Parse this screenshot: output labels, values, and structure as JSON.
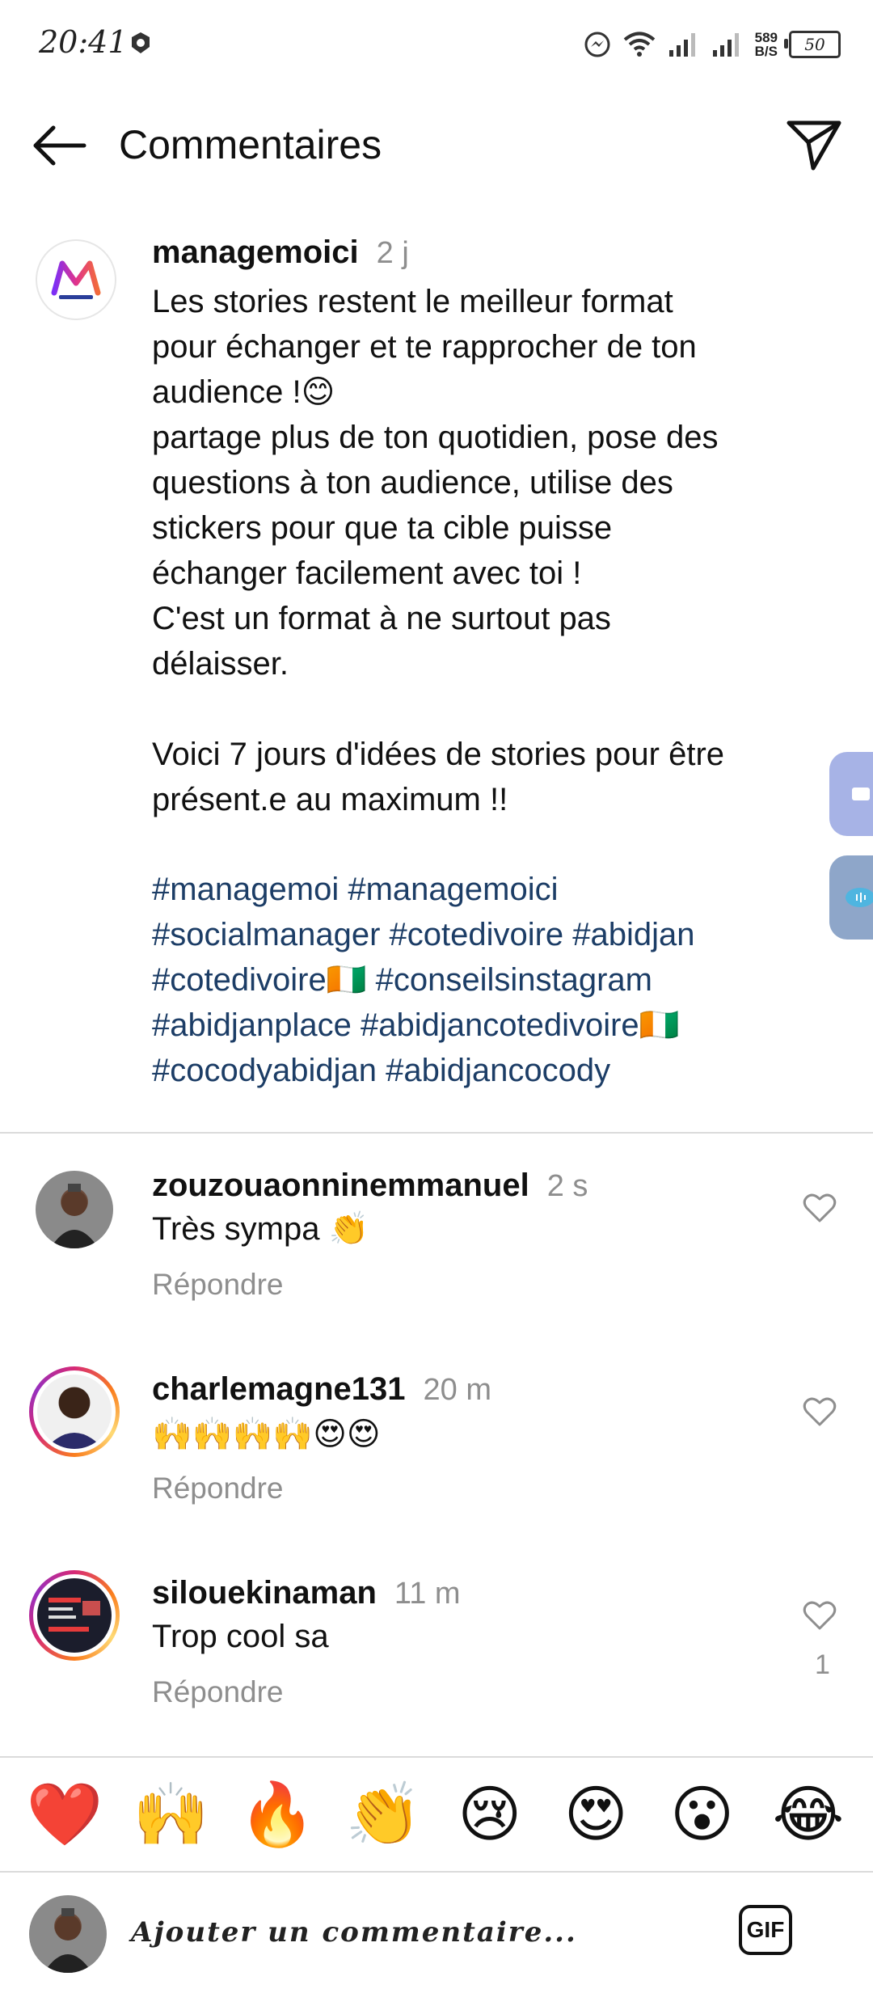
{
  "status_bar": {
    "time": "20:41",
    "speed_value": "589",
    "speed_unit": "B/S",
    "battery": "50"
  },
  "header": {
    "title": "Commentaires"
  },
  "caption": {
    "username": "managemoici",
    "time": "2 j",
    "text": "Les stories restent le meilleur format\npour échanger et te rapprocher de ton\naudience !😊\npartage plus de ton quotidien, pose des\nquestions à ton audience, utilise des\nstickers pour que ta cible puisse\néchanger facilement avec toi !\nC'est un format à ne surtout pas\ndélaisser.\n\nVoici 7 jours d'idées de stories pour être\nprésent.e au maximum !!",
    "hashtag_lines": [
      "#managemoi #managemoici",
      "#socialmanager #cotedivoire #abidjan",
      "#cotedivoire🇨🇮 #conseilsinstagram",
      "#abidjanplace #abidjancotedivoire🇨🇮",
      "#cocodyabidjan #abidjancocody"
    ]
  },
  "comments": [
    {
      "username": "zouzouaonninemmanuel",
      "time": "2 s",
      "text": "Très sympa 👏",
      "reply": "Répondre",
      "likes": ""
    },
    {
      "username": "charlemagne131",
      "time": "20 m",
      "text": "🙌🙌🙌🙌😍😍",
      "reply": "Répondre",
      "likes": ""
    },
    {
      "username": "silouekinaman",
      "time": "11 m",
      "text": "Trop cool sa",
      "reply": "Répondre",
      "likes": "1"
    }
  ],
  "reactions": [
    "❤️",
    "🙌",
    "🔥",
    "👏",
    "😢",
    "😍",
    "😮",
    "😂"
  ],
  "input": {
    "placeholder": "Ajouter un commentaire...",
    "gif_label": "GIF"
  },
  "colors": {
    "hashtag": "#1c3d66",
    "muted": "#8e8e8e",
    "side_button_top": "#a7b3e6",
    "side_button_bottom": "#8ea6c9"
  }
}
